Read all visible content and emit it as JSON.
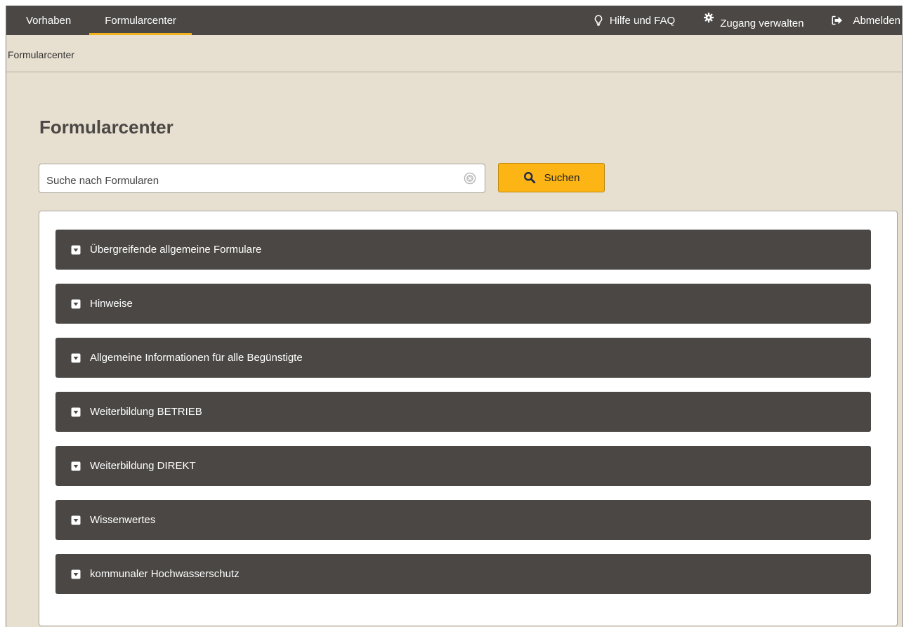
{
  "nav": {
    "tabs": [
      {
        "label": "Vorhaben"
      },
      {
        "label": "Formularcenter",
        "active": true
      }
    ],
    "links": {
      "help": {
        "label": "Hilfe und FAQ",
        "icon": "lightbulb-icon"
      },
      "access": {
        "label": "Zugang verwalten",
        "icon": "gear-icon"
      },
      "logout": {
        "label": "Abmelden",
        "icon": "logout-icon"
      }
    }
  },
  "breadcrumb": {
    "current": "Formularcenter"
  },
  "page": {
    "title": "Formularcenter"
  },
  "search": {
    "placeholder": "Suche nach Formularen",
    "value": "",
    "button_label": "Suchen",
    "button_icon": "search-icon",
    "clear_icon": "clear-icon"
  },
  "accordion": {
    "items": [
      {
        "label": "Übergreifende allgemeine Formulare"
      },
      {
        "label": "Hinweise"
      },
      {
        "label": "Allgemeine Informationen für alle Begünstigte"
      },
      {
        "label": "Weiterbildung BETRIEB"
      },
      {
        "label": "Weiterbildung DIREKT"
      },
      {
        "label": "Wissenwertes"
      },
      {
        "label": "kommunaler Hochwasserschutz"
      }
    ]
  },
  "colors": {
    "topbar": "#4a4744",
    "accent": "#f2b21c",
    "button": "#fdb515",
    "background": "#e7e0d0",
    "accordion": "#4a4744"
  }
}
